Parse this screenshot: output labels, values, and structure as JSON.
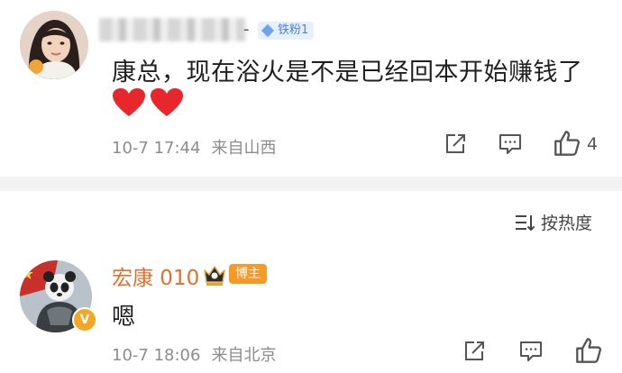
{
  "comment1": {
    "fan_badge_label": "铁粉1",
    "name_suffix": "-",
    "text": "康总，现在浴火是不是已经回本开始赚钱了",
    "date": "10-7 17:44",
    "location": "来自山西",
    "like_count": "4"
  },
  "sort": {
    "label": "按热度"
  },
  "comment2": {
    "author": "宏康 010",
    "role_badge": "博主",
    "verified_mark": "V",
    "text": "嗯",
    "date": "10-7 18:06",
    "location": "来自北京"
  },
  "colors": {
    "accent_orange": "#e0702d",
    "heart_red": "#e8272c",
    "meta_gray": "#8c8c8c",
    "badge_blue": "#4f84d9"
  },
  "icons": [
    "share-icon",
    "comment-icon",
    "like-icon",
    "sort-icon",
    "crown-icon",
    "heart-emoji"
  ]
}
